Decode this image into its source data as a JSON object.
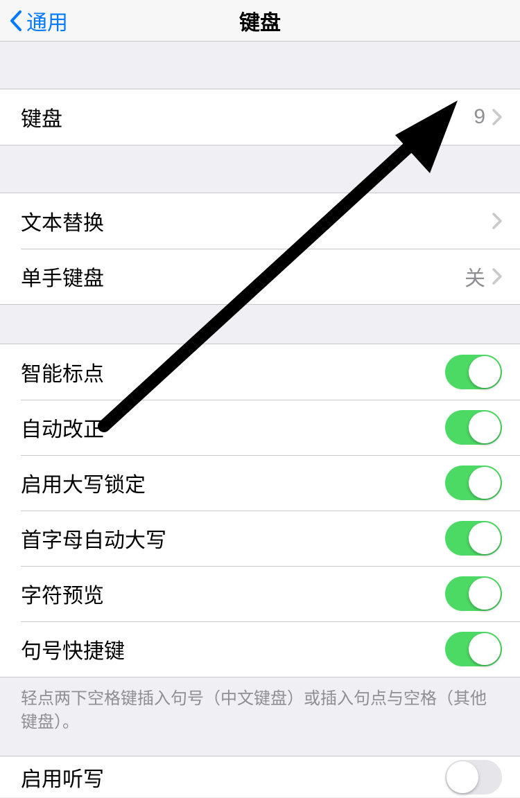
{
  "navbar": {
    "back_label": "通用",
    "title": "键盘"
  },
  "section1": {
    "keyboards_label": "键盘",
    "keyboards_count": "9"
  },
  "section2": {
    "text_replacement_label": "文本替换",
    "one_handed_label": "单手键盘",
    "one_handed_value": "关"
  },
  "section3": {
    "smart_punctuation_label": "智能标点",
    "auto_correction_label": "自动改正",
    "caps_lock_label": "启用大写锁定",
    "auto_capitalization_label": "首字母自动大写",
    "char_preview_label": "字符预览",
    "period_shortcut_label": "句号快捷键",
    "footer": "轻点两下空格键插入句号（中文键盘）或插入句点与空格（其他键盘）。"
  },
  "section4": {
    "enable_dictation_label": "启用听写"
  }
}
